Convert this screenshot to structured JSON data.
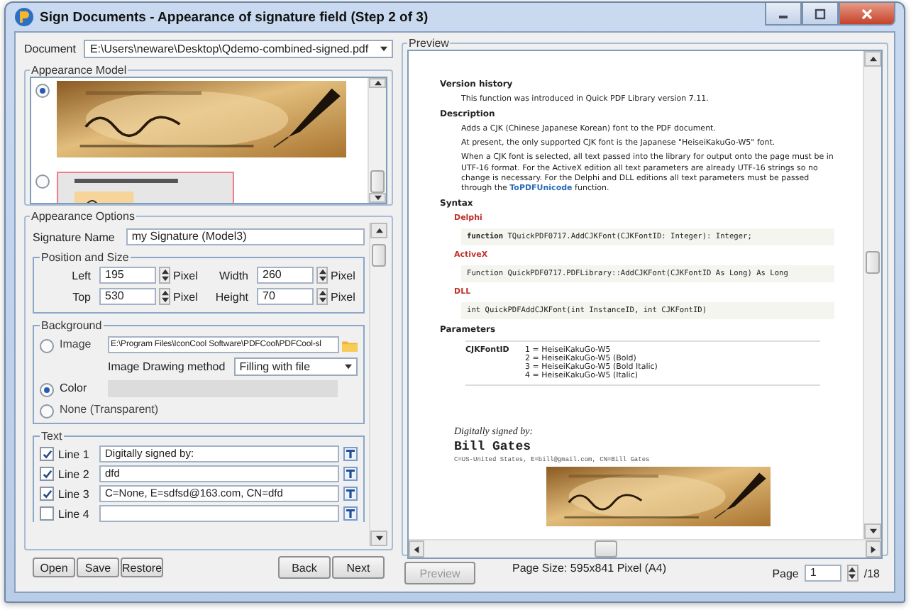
{
  "window": {
    "title": "Sign Documents - Appearance of signature field (Step 2 of 3)"
  },
  "document": {
    "label": "Document",
    "value": "E:\\Users\\neware\\Desktop\\Qdemo-combined-signed.pdf"
  },
  "appearance_model": {
    "title": "Appearance Model",
    "models": [
      {
        "kind": "picture",
        "selected": true
      },
      {
        "kind": "picture",
        "selected": false
      }
    ]
  },
  "appearance_options": {
    "title": "Appearance Options",
    "signature_name": {
      "label": "Signature Name",
      "value": "my Signature (Model3)"
    },
    "position_size": {
      "title": "Position and Size",
      "fields": [
        {
          "label": "Left",
          "value": "195",
          "unit": "Pixel"
        },
        {
          "label": "Width",
          "value": "260",
          "unit": "Pixel"
        },
        {
          "label": "Top",
          "value": "530",
          "unit": "Pixel"
        },
        {
          "label": "Height",
          "value": "70",
          "unit": "Pixel"
        }
      ]
    },
    "background": {
      "title": "Background",
      "options": [
        {
          "label": "Image",
          "selected": false
        },
        {
          "label": "Color",
          "selected": true
        },
        {
          "label": "None (Transparent)",
          "selected": false
        }
      ],
      "image_path": "E:\\Program Files\\IconCool Software\\PDFCool\\PDFCool-sl",
      "drawing_method": {
        "label": "Image Drawing method",
        "value": "Filling with file"
      }
    },
    "text": {
      "title": "Text",
      "lines": [
        {
          "label": "Line 1",
          "checked": true,
          "value": "Digitally signed by:"
        },
        {
          "label": "Line 2",
          "checked": true,
          "value": "dfd"
        },
        {
          "label": "Line 3",
          "checked": true,
          "value": "C=None, E=sdfsd@163.com, CN=dfd"
        },
        {
          "label": "Line 4",
          "checked": false
        }
      ]
    }
  },
  "left_buttons": [
    "Open",
    "Save",
    "Restore"
  ],
  "nav_buttons": [
    "Back",
    "Next"
  ],
  "preview": {
    "title": "Preview",
    "blocks": [
      {
        "kind": "heading",
        "text": "Version history"
      },
      {
        "kind": "para",
        "text": "This function was introduced in Quick PDF Library version 7.11."
      },
      {
        "kind": "heading",
        "text": "Description"
      },
      {
        "kind": "para",
        "text": "Adds a CJK (Chinese Japanese Korean) font to the PDF document."
      },
      {
        "kind": "para",
        "text": "At present, the only supported CJK font is the Japanese \"HeiseiKakuGo-W5\" font."
      },
      {
        "kind": "para",
        "text": "When a CJK font is selected, all text passed into the library for output onto the page must be in UTF-16 format. For the ActiveX edition all text parameters are already UTF-16 strings so no change is necessary. For the Delphi and DLL editions all text parameters must be passed through the ",
        "link": "ToPDFUnicode",
        "after": " function."
      },
      {
        "kind": "heading",
        "text": "Syntax"
      },
      {
        "kind": "lang",
        "text": "Delphi"
      },
      {
        "kind": "code",
        "text": "**function** TQuickPDF0717.AddCJKFont(CJKFontID: Integer): Integer;"
      },
      {
        "kind": "lang",
        "text": "ActiveX"
      },
      {
        "kind": "code",
        "text": "Function QuickPDF0717.PDFLibrary::AddCJKFont(CJKFontID As Long) As Long"
      },
      {
        "kind": "lang",
        "text": "DLL"
      },
      {
        "kind": "code",
        "text": "int QuickPDFAddCJKFont(int InstanceID, int CJKFontID)"
      },
      {
        "kind": "heading",
        "text": "Parameters"
      },
      {
        "kind": "param",
        "name": "CJKFontID",
        "values": [
          "1 = HeiseiKakuGo-W5",
          "2 = HeiseiKakuGo-W5 (Bold)",
          "3 = HeiseiKakuGo-W5 (Bold Italic)",
          "4 = HeiseiKakuGo-W5 (Italic)"
        ]
      }
    ],
    "signature": {
      "caption": "Digitally signed by:",
      "name": "Bill Gates",
      "details": "C=US-United States, E=bill@gmail.com, CN=Bill Gates",
      "stamp": {
        "kind": "picture"
      }
    },
    "preview_button": {
      "label": "Preview",
      "disabled": true
    },
    "page_size": "Page Size: 595x841 Pixel  (A4)",
    "page": {
      "label": "Page",
      "value": "1",
      "total": "/18"
    }
  }
}
